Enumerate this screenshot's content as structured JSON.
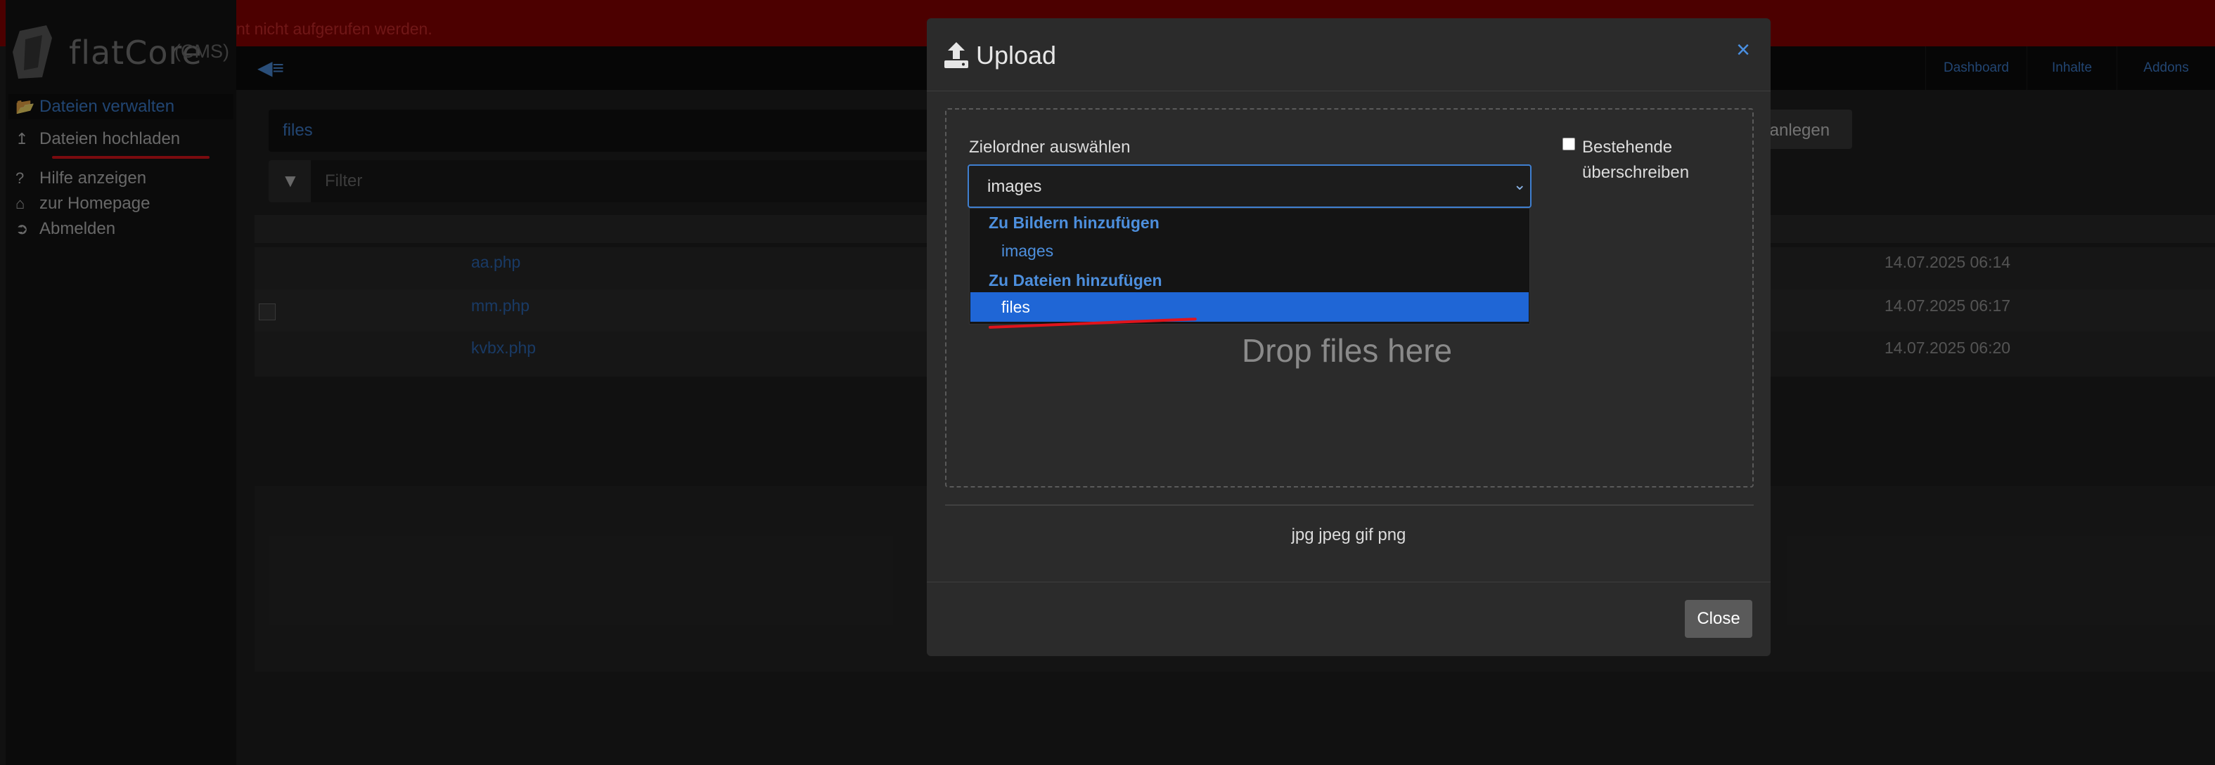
{
  "error_bar": {
    "text": "nt nicht aufgerufen werden."
  },
  "topnav": {
    "items": [
      {
        "label": "Dashboard"
      },
      {
        "label": "Inhalte"
      },
      {
        "label": "Addons"
      }
    ]
  },
  "logo": {
    "name": "flatCore",
    "suffix": "(CMS)"
  },
  "sidebar": {
    "items": [
      {
        "label": "Dateien verwalten",
        "icon": "folder-open-icon"
      },
      {
        "label": "Dateien hochladen",
        "icon": "upload-icon"
      },
      {
        "label": "Hilfe anzeigen",
        "icon": "question-icon"
      },
      {
        "label": "zur Homepage",
        "icon": "home-icon"
      },
      {
        "label": "Abmelden",
        "icon": "sign-out-icon"
      }
    ]
  },
  "main": {
    "current_folder": "files",
    "filter_placeholder": "Filter",
    "create_button_label": "r anlegen",
    "files": [
      {
        "name": "aa.php",
        "date": "14.07.2025 06:14"
      },
      {
        "name": "mm.php",
        "date": "14.07.2025 06:17"
      },
      {
        "name": "kvbx.php",
        "date": "14.07.2025 06:20"
      }
    ]
  },
  "modal": {
    "title": "Upload",
    "close_glyph": "×",
    "target_label": "Zielordner auswählen",
    "selected": "images",
    "dropdown": {
      "groups": [
        {
          "label": "Zu Bildern hinzufügen",
          "options": [
            "images"
          ]
        },
        {
          "label": "Zu Dateien hinzufügen",
          "options": [
            "files"
          ]
        }
      ],
      "highlighted": "files"
    },
    "overwrite_label": "Bestehende überschreiben",
    "overwrite_checked": false,
    "drop_text": "Drop files here",
    "extensions": "jpg jpeg gif png",
    "close_button": "Close"
  },
  "colors": {
    "accent": "#3f7fd0",
    "error_bar": "#8b0000",
    "highlight": "#1f66d6",
    "annotation_red": "#e0141c"
  }
}
